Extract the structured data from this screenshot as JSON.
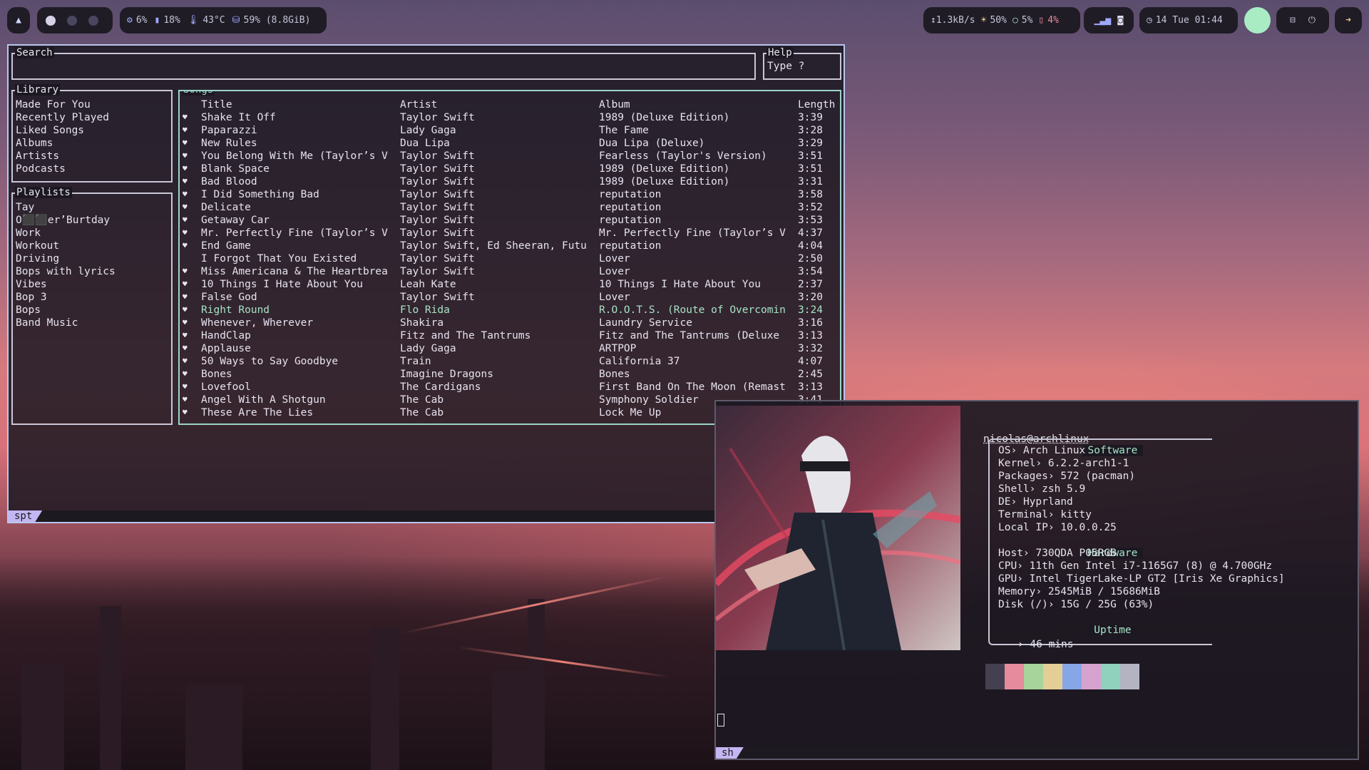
{
  "topbar": {
    "launcher_icon": "arch-icon",
    "workspaces": [
      {
        "active": true
      },
      {
        "active": false
      },
      {
        "active": false
      }
    ],
    "system": {
      "cpu": "6%",
      "mem": "18%",
      "temp": "43°C",
      "disk": "59% (8.8GiB)"
    },
    "network": "↕1.3kB/s",
    "brightness": "50%",
    "volume": "5%",
    "battery": "4%",
    "date": "14 Tue 01:44",
    "icons": [
      "wifi-icon",
      "discord-icon",
      "clock-icon",
      "power-icon",
      "logout-icon"
    ]
  },
  "spt": {
    "search_label": "Search",
    "search_value": "",
    "help_label": "Help",
    "help_text": "Type ?",
    "library_label": "Library",
    "library_items": [
      "Made For You",
      "Recently Played",
      "Liked Songs",
      "Albums",
      "Artists",
      "Podcasts"
    ],
    "playlists_label": "Playlists",
    "playlists": [
      "Tay",
      "O⬛⬛er’Burtday",
      "Work",
      "Workout",
      "Driving",
      "Bops with lyrics",
      "Vibes",
      "Bop 3",
      "Bops",
      "Band Music"
    ],
    "songs_label": "Songs",
    "columns": {
      "title": "Title",
      "artist": "Artist",
      "album": "Album",
      "length": "Length"
    },
    "songs": [
      {
        "liked": true,
        "title": "Shake It Off",
        "artist": "Taylor Swift",
        "album": "1989 (Deluxe Edition)",
        "length": "3:39"
      },
      {
        "liked": true,
        "title": "Paparazzi",
        "artist": "Lady Gaga",
        "album": "The Fame",
        "length": "3:28"
      },
      {
        "liked": true,
        "title": "New Rules",
        "artist": "Dua Lipa",
        "album": "Dua Lipa (Deluxe)",
        "length": "3:29"
      },
      {
        "liked": true,
        "title": "You Belong With Me (Taylor’s V",
        "artist": "Taylor Swift",
        "album": "Fearless (Taylor's Version)",
        "length": "3:51"
      },
      {
        "liked": true,
        "title": "Blank Space",
        "artist": "Taylor Swift",
        "album": "1989 (Deluxe Edition)",
        "length": "3:51"
      },
      {
        "liked": true,
        "title": "Bad Blood",
        "artist": "Taylor Swift",
        "album": "1989 (Deluxe Edition)",
        "length": "3:31"
      },
      {
        "liked": true,
        "title": "I Did Something Bad",
        "artist": "Taylor Swift",
        "album": "reputation",
        "length": "3:58"
      },
      {
        "liked": true,
        "title": "Delicate",
        "artist": "Taylor Swift",
        "album": "reputation",
        "length": "3:52"
      },
      {
        "liked": true,
        "title": "Getaway Car",
        "artist": "Taylor Swift",
        "album": "reputation",
        "length": "3:53"
      },
      {
        "liked": true,
        "title": "Mr. Perfectly Fine (Taylor’s V",
        "artist": "Taylor Swift",
        "album": "Mr. Perfectly Fine (Taylor’s V",
        "length": "4:37"
      },
      {
        "liked": true,
        "title": "End Game",
        "artist": "Taylor Swift, Ed Sheeran, Futu",
        "album": "reputation",
        "length": "4:04"
      },
      {
        "liked": false,
        "title": "I Forgot That You Existed",
        "artist": "Taylor Swift",
        "album": "Lover",
        "length": "2:50"
      },
      {
        "liked": true,
        "title": "Miss Americana & The Heartbrea",
        "artist": "Taylor Swift",
        "album": "Lover",
        "length": "3:54"
      },
      {
        "liked": true,
        "title": "10 Things I Hate About You",
        "artist": "Leah Kate",
        "album": "10 Things I Hate About You",
        "length": "2:37"
      },
      {
        "liked": true,
        "title": "False God",
        "artist": "Taylor Swift",
        "album": "Lover",
        "length": "3:20"
      },
      {
        "liked": true,
        "title": "Right Round",
        "artist": "Flo Rida",
        "album": "R.O.O.T.S. (Route of Overcomin",
        "length": "3:24",
        "playing": true
      },
      {
        "liked": true,
        "title": "Whenever, Wherever",
        "artist": "Shakira",
        "album": "Laundry Service",
        "length": "3:16"
      },
      {
        "liked": true,
        "title": "HandClap",
        "artist": "Fitz and The Tantrums",
        "album": "Fitz and The Tantrums (Deluxe",
        "length": "3:13"
      },
      {
        "liked": true,
        "title": "Applause",
        "artist": "Lady Gaga",
        "album": "ARTPOP",
        "length": "3:32"
      },
      {
        "liked": true,
        "title": "50 Ways to Say Goodbye",
        "artist": "Train",
        "album": "California 37",
        "length": "4:07"
      },
      {
        "liked": true,
        "title": "Bones",
        "artist": "Imagine Dragons",
        "album": "Bones",
        "length": "2:45"
      },
      {
        "liked": true,
        "title": "Lovefool",
        "artist": "The Cardigans",
        "album": "First Band On The Moon (Remast",
        "length": "3:13"
      },
      {
        "liked": true,
        "title": "Angel With A Shotgun",
        "artist": "The Cab",
        "album": "Symphony Soldier",
        "length": "3:41"
      },
      {
        "liked": true,
        "title": "These Are The Lies",
        "artist": "The Cab",
        "album": "Lock Me Up",
        "length": ""
      }
    ],
    "tag": "spt"
  },
  "terminal": {
    "user": "nicolas@archlinux",
    "software_label": "Software",
    "software": [
      {
        "k": "OS›",
        "v": "Arch Linux"
      },
      {
        "k": "Kernel›",
        "v": "6.2.2-arch1-1"
      },
      {
        "k": "Packages›",
        "v": "572 (pacman)"
      },
      {
        "k": "Shell›",
        "v": "zsh 5.9"
      },
      {
        "k": "DE›",
        "v": "Hyprland"
      },
      {
        "k": "Terminal›",
        "v": "kitty"
      },
      {
        "k": "Local IP›",
        "v": "10.0.0.25"
      }
    ],
    "hardware_label": "Hardware",
    "hardware": [
      {
        "k": "Host›",
        "v": "730QDA P05RGB"
      },
      {
        "k": "CPU›",
        "v": "11th Gen Intel i7-1165G7 (8) @ 4.700GHz"
      },
      {
        "k": "GPU›",
        "v": "Intel TigerLake-LP GT2 [Iris Xe Graphics]"
      },
      {
        "k": "Memory›",
        "v": "2545MiB / 15686MiB"
      },
      {
        "k": "Disk (/)›",
        "v": "15G / 25G (63%)"
      }
    ],
    "uptime_label": "Uptime",
    "uptime": "› 46 mins",
    "palette": [
      "#45404f",
      "#e68a9e",
      "#a6d49a",
      "#e3cf96",
      "#86a6e8",
      "#d6a2cf",
      "#8fd1bd",
      "#b3b3c2"
    ],
    "tag": "sh"
  }
}
